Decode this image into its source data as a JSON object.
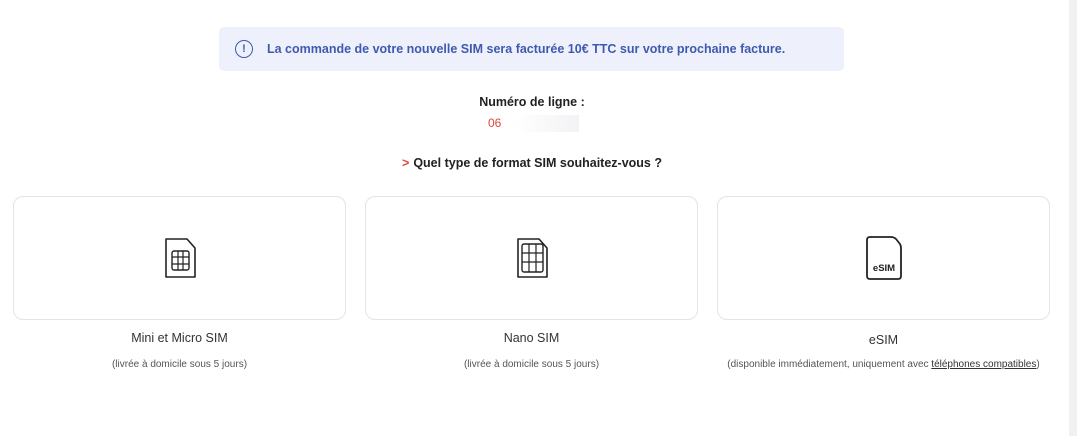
{
  "banner": {
    "icon": "exclamation-circle-icon",
    "text": "La commande de votre nouvelle SIM sera facturée 10€ TTC sur votre prochaine facture.",
    "color": "#3e5ab0",
    "background": "#eef1fb"
  },
  "line": {
    "label": "Numéro de ligne :",
    "value": "06"
  },
  "question": {
    "arrow": ">",
    "text": "Quel type de format SIM souhaitez-vous ?"
  },
  "options": [
    {
      "icon": "mini-sim-card-icon",
      "title": "Mini et Micro SIM",
      "subtitle": "(livrée à domicile sous 5 jours)"
    },
    {
      "icon": "nano-sim-card-icon",
      "title": "Nano SIM",
      "subtitle": "(livrée à domicile sous 5 jours)"
    },
    {
      "icon": "esim-card-icon",
      "icon_text": "eSIM",
      "title": "eSIM",
      "subtitle_prefix": "(disponible immédiatement, uniquement avec",
      "subtitle_link": "téléphones compatibles",
      "subtitle_suffix": ")"
    }
  ],
  "colors": {
    "accent_red": "#d84a3a",
    "card_border": "#e3e3e8",
    "text": "#333333"
  }
}
